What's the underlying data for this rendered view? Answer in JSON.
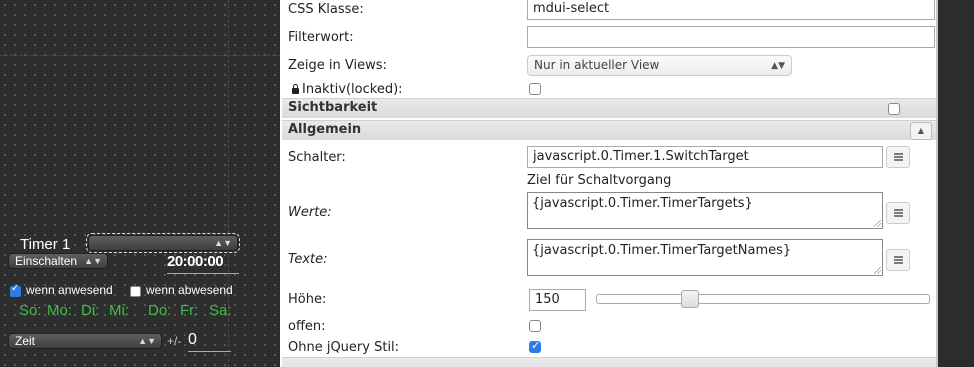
{
  "canvas": {
    "timer_widget": {
      "title": "Timer 1",
      "select_arrows": "▲▼",
      "action_select": "Einschalten",
      "time_display": "20:00:00",
      "checkbox_present": {
        "label": "wenn anwesend",
        "checked": true
      },
      "checkbox_absent": {
        "label": "wenn abwesend",
        "checked": false
      },
      "days": [
        "So:",
        "Mo:",
        "Di:",
        "Mi:",
        "Do:",
        "Fr:",
        "Sa:"
      ],
      "time_mode_select": "Zeit",
      "offset_label": "+/-",
      "offset_value": "0"
    }
  },
  "properties": {
    "css_class": {
      "label": "CSS Klasse:",
      "value": "mdui-select"
    },
    "filter_word": {
      "label": "Filterwort:",
      "value": ""
    },
    "show_in_views": {
      "label": "Zeige in Views:",
      "value": "Nur in aktueller View"
    },
    "inactive_locked": {
      "label": "Inaktiv(locked):",
      "checked": false
    },
    "sections": {
      "visibility": {
        "title": "Sichtbarkeit",
        "checked": false
      },
      "general": {
        "title": "Allgemein",
        "collapse_icon": "▲"
      }
    },
    "switch": {
      "label": "Schalter:",
      "value": "javascript.0.Timer.1.SwitchTarget",
      "hint": "Ziel für Schaltvorgang"
    },
    "values": {
      "label": "Werte:",
      "value": "{javascript.0.Timer.TimerTargets}"
    },
    "texts": {
      "label": "Texte:",
      "value": "{javascript.0.Timer.TimerTargetNames}"
    },
    "height": {
      "label": "Höhe:",
      "value": "150",
      "slider_fraction": 0.27
    },
    "open": {
      "label": "offen:",
      "checked": false
    },
    "no_jquery_style": {
      "label": "Ohne jQuery Stil:",
      "checked": true
    }
  },
  "colors": {
    "canvas_bg": "#2e2e2e",
    "day_green": "#3fbf45",
    "checkbox_accent": "#2f7ae5",
    "section_bar": "#e2e2e2"
  }
}
